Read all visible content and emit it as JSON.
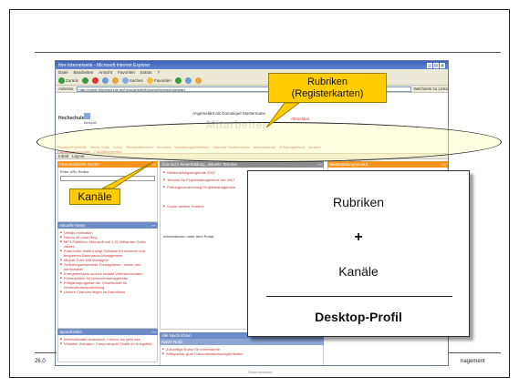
{
  "browser": {
    "title": "Ihre Internetseite - Microsoft Internet Explorer",
    "menu": [
      "Datei",
      "Bearbeiten",
      "Ansicht",
      "Favoriten",
      "Extras",
      "?"
    ],
    "toolbar": [
      "Zurück",
      "Suchen",
      "Favoriten"
    ],
    "address_label": "Adresse",
    "address_value": "http://portal.fhlochschule.de/hs/p/de/site/fh/portal/hochschule/start",
    "links_label": "Wechseln zu  Links"
  },
  "portal": {
    "logo": "Hochschule",
    "logo_sub": "Beispiel",
    "logged_in": "Angemeldet als Dominique Mustermann",
    "logout": "Abmelden",
    "big_title": "Mitarbeiter",
    "tabs": [
      "Projekte/Fachhilfe",
      "Meine Seite",
      "Kurse",
      "Personalthemen",
      "Services",
      "Verwaltungseinheiten",
      "Standort Fachbereiche",
      "Informationen",
      "IT-Management",
      "Intranet"
    ],
    "tabs_row2": [
      "Fachbereichsportale",
      "Fakultätsgremien"
    ],
    "subnav": [
      "Inhalt",
      "Layout"
    ]
  },
  "panels": {
    "left_top": "Personalisierte Suche",
    "left_search_label": "Enter URL Reiten",
    "news_title": "Aktuelle News",
    "news": [
      "Details motivation",
      "Hands-off ohne Ring",
      "MP3-Plattform: Microsoft soll 1,02 Milliarden Dollar zahlen",
      "Fraunhofer-Institut zeigt Software für sicheren und bequemen Datenraum-Management",
      "Mozart-Suite hilft Managern",
      "Selbstorganisierende Funksysteme - sicher und komfortabel",
      "Energiefressers suchen besser Verbrauchsdaten",
      "Führerschein für Unternehmensgründer",
      "Frühjahrsprognose der Gesellschaft für Informationsverarbeitung",
      "Unsere Chancen liegen im Datenfluss"
    ],
    "bottom_left_title": "Sprachstelle",
    "bottom_left_items": [
      "Internationaler Austausch: Lernen, wo geht das",
      "Virtueller Zeitraum: Computerspiel Grafik im Kriegsfeld"
    ],
    "mid_title": "Übersicht Weiterbildung, aktuelle Termine",
    "mid_items": [
      "Weiterbildungsangebote 2007",
      "Termine für Projektmanagement Jan 2007",
      "Prüfungsvorbereitung Projektmanagement"
    ],
    "mid_side": [
      "Seminar",
      "Workshop",
      "Bildungsprogramm"
    ],
    "mid_more": "Suche weitere Termine",
    "mid_note": "Informationen unter dem Portal",
    "right_title": "Weiterbildungsmodul",
    "bottom_right_title": "Alle Nachrichten",
    "bottom_right_sub": "Kurze Notiz",
    "bottom_right_items": [
      "Zukünftige Kurse für Interessierte",
      "Webquests: gute Dokumentationsmöglichkeiten"
    ]
  },
  "annotations": {
    "callout_top": [
      "Rubriken",
      "(Registerkarten)"
    ],
    "callout_left": "Kanäle"
  },
  "summary": {
    "line1": "Rubriken",
    "plus": "+",
    "line2": "Kanäle",
    "result": "Desktop-Profil"
  },
  "footer": {
    "left": "26.0",
    "right": "nagement",
    "mid": "Dokumentation"
  },
  "colors": {
    "callout": "#ffcc00",
    "orange_panel": "#f7941d",
    "blue_panel": "#6d8cc7",
    "tab_text": "#cc3333"
  }
}
